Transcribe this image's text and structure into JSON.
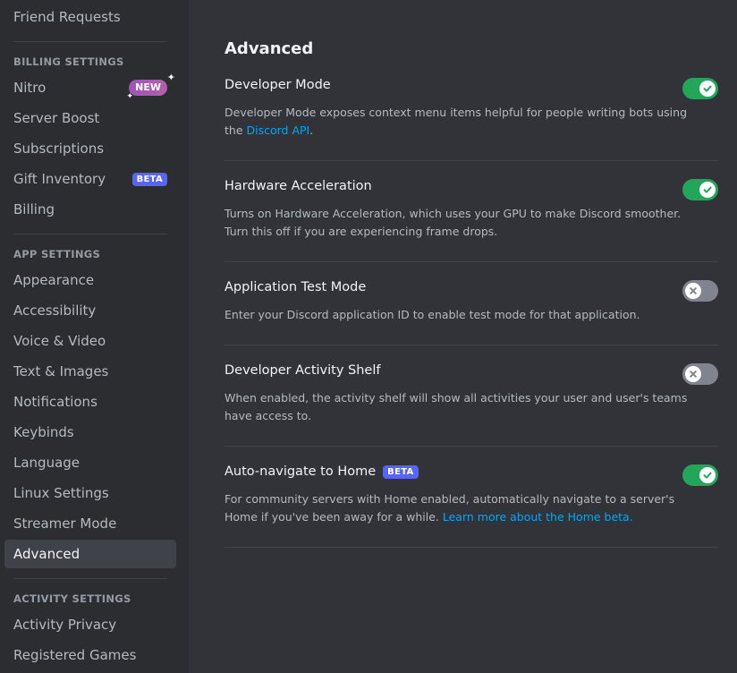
{
  "sidebar": {
    "friend_requests": "Friend Requests",
    "billing_header": "BILLING SETTINGS",
    "billing_items": [
      {
        "label": "Nitro",
        "badge": "NEW"
      },
      {
        "label": "Server Boost"
      },
      {
        "label": "Subscriptions"
      },
      {
        "label": "Gift Inventory",
        "badge": "BETA"
      },
      {
        "label": "Billing"
      }
    ],
    "app_header": "APP SETTINGS",
    "app_items": [
      {
        "label": "Appearance"
      },
      {
        "label": "Accessibility"
      },
      {
        "label": "Voice & Video"
      },
      {
        "label": "Text & Images"
      },
      {
        "label": "Notifications"
      },
      {
        "label": "Keybinds"
      },
      {
        "label": "Language"
      },
      {
        "label": "Linux Settings"
      },
      {
        "label": "Streamer Mode"
      },
      {
        "label": "Advanced",
        "active": true
      }
    ],
    "activity_header": "ACTIVITY SETTINGS",
    "activity_items": [
      {
        "label": "Activity Privacy"
      },
      {
        "label": "Registered Games"
      }
    ]
  },
  "main": {
    "title": "Advanced",
    "settings": [
      {
        "title": "Developer Mode",
        "desc": "Developer Mode exposes context menu items helpful for people writing bots using the ",
        "link": "Discord API",
        "desc_after": ".",
        "enabled": true
      },
      {
        "title": "Hardware Acceleration",
        "desc": "Turns on Hardware Acceleration, which uses your GPU to make Discord smoother. Turn this off if you are experiencing frame drops.",
        "enabled": true
      },
      {
        "title": "Application Test Mode",
        "desc": "Enter your Discord application ID to enable test mode for that application.",
        "enabled": false
      },
      {
        "title": "Developer Activity Shelf",
        "desc": "When enabled, the activity shelf will show all activities your user and user's teams have access to.",
        "enabled": false
      },
      {
        "title": "Auto-navigate to Home",
        "badge": "BETA",
        "desc": "For community servers with Home enabled, automatically navigate to a server's Home if you've been away for a while. ",
        "link": "Learn more about the Home beta.",
        "enabled": true
      }
    ]
  },
  "colors": {
    "toggle_on": "#23a55a",
    "toggle_off": "#80848e",
    "link": "#00a8fc",
    "beta_badge": "#5865f2"
  }
}
